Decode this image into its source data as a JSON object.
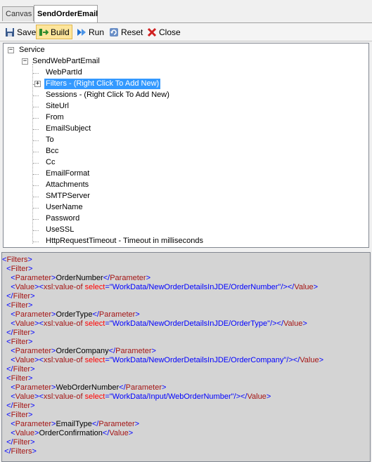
{
  "tabs": [
    {
      "label": "Canvas",
      "active": false
    },
    {
      "label": "SendOrderEmail",
      "active": true
    }
  ],
  "toolbar": {
    "save": "Save",
    "build": "Build",
    "run": "Run",
    "reset": "Reset",
    "close": "Close"
  },
  "tree": {
    "root": "Service",
    "child": "SendWebPartEmail",
    "items": [
      "WebPartId",
      "Filters - (Right Click To Add New)",
      "Sessions - (Right Click To Add New)",
      "SiteUrl",
      "From",
      "EmailSubject",
      "To",
      "Bcc",
      "Cc",
      "EmailFormat",
      "Attachments",
      "SMTPServer",
      "UserName",
      "Password",
      "UseSSL",
      "HttpRequestTimeout - Timeout in milliseconds"
    ],
    "selected_index": 1
  },
  "xml": {
    "filters_tag": "Filters",
    "filter_tag": "Filter",
    "parameter_tag": "Parameter",
    "value_tag": "Value",
    "xsl_tag": "xsl:value-of",
    "select_attr": "select",
    "entries": [
      {
        "parameter": "OrderNumber",
        "select": "WorkData/NewOrderDetailsInJDE/OrderNumber"
      },
      {
        "parameter": "OrderType",
        "select": "WorkData/NewOrderDetailsInJDE/OrderType"
      },
      {
        "parameter": "OrderCompany",
        "select": "WorkData/NewOrderDetailsInJDE/OrderCompany"
      },
      {
        "parameter": "WebOrderNumber",
        "select": "WorkData/Input/WebOrderNumber"
      },
      {
        "parameter": "EmailType",
        "value": "OrderConfirmation"
      }
    ]
  },
  "colors": {
    "selection": "#3399ff",
    "xml_bracket": "#0000ff",
    "xml_tag": "#a31515",
    "xml_attr": "#ff0000",
    "xml_attr_value": "#0000ff",
    "xml_background": "#d4d4d4"
  }
}
